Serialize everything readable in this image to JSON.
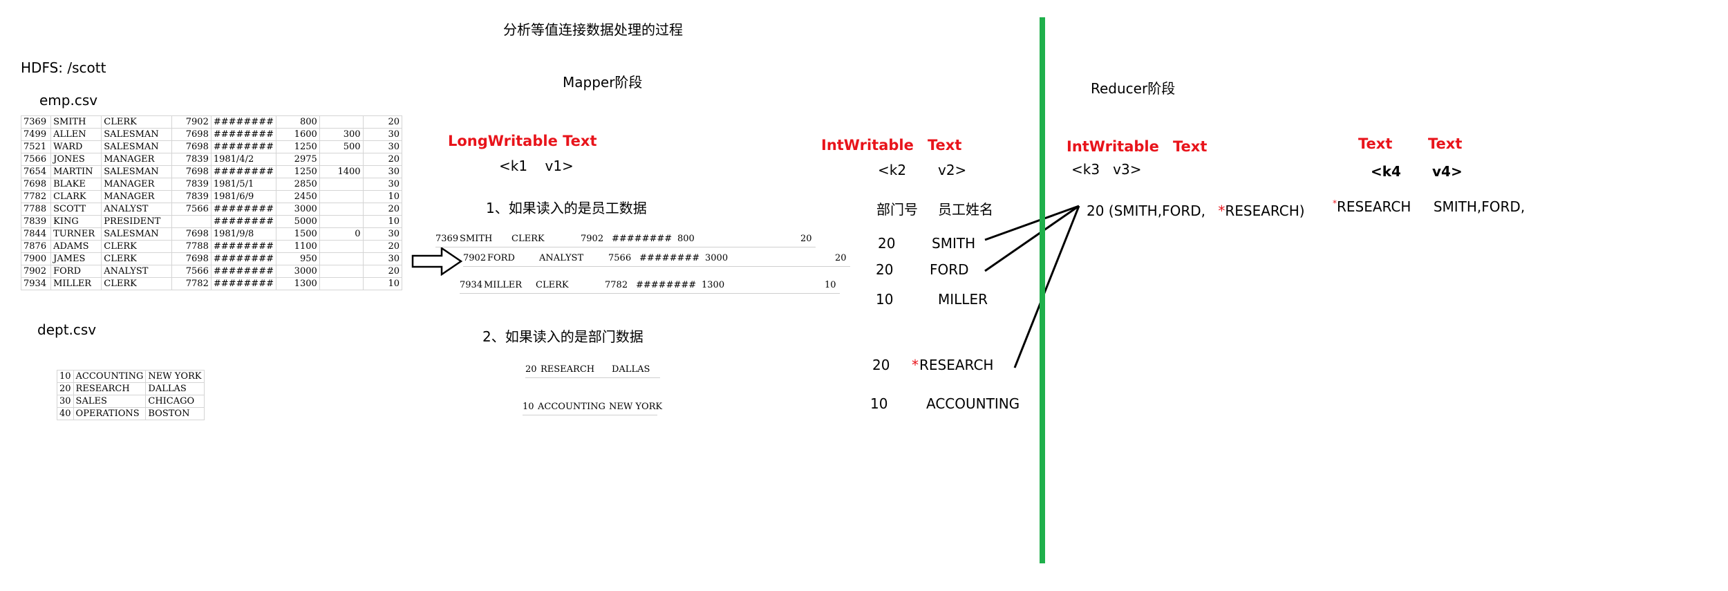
{
  "title": "分析等值连接数据处理的过程",
  "hdfs_label": "HDFS: /scott",
  "emp_label": "emp.csv",
  "dept_label": "dept.csv",
  "emp_rows": [
    [
      "7369",
      "SMITH",
      "CLERK",
      "7902",
      "########",
      "800",
      "",
      "20"
    ],
    [
      "7499",
      "ALLEN",
      "SALESMAN",
      "7698",
      "########",
      "1600",
      "300",
      "30"
    ],
    [
      "7521",
      "WARD",
      "SALESMAN",
      "7698",
      "########",
      "1250",
      "500",
      "30"
    ],
    [
      "7566",
      "JONES",
      "MANAGER",
      "7839",
      "1981/4/2",
      "2975",
      "",
      "20"
    ],
    [
      "7654",
      "MARTIN",
      "SALESMAN",
      "7698",
      "########",
      "1250",
      "1400",
      "30"
    ],
    [
      "7698",
      "BLAKE",
      "MANAGER",
      "7839",
      "1981/5/1",
      "2850",
      "",
      "30"
    ],
    [
      "7782",
      "CLARK",
      "MANAGER",
      "7839",
      "1981/6/9",
      "2450",
      "",
      "10"
    ],
    [
      "7788",
      "SCOTT",
      "ANALYST",
      "7566",
      "########",
      "3000",
      "",
      "20"
    ],
    [
      "7839",
      "KING",
      "PRESIDENT",
      "",
      "########",
      "5000",
      "",
      "10"
    ],
    [
      "7844",
      "TURNER",
      "SALESMAN",
      "7698",
      "1981/9/8",
      "1500",
      "0",
      "30"
    ],
    [
      "7876",
      "ADAMS",
      "CLERK",
      "7788",
      "########",
      "1100",
      "",
      "20"
    ],
    [
      "7900",
      "JAMES",
      "CLERK",
      "7698",
      "########",
      "950",
      "",
      "30"
    ],
    [
      "7902",
      "FORD",
      "ANALYST",
      "7566",
      "########",
      "3000",
      "",
      "20"
    ],
    [
      "7934",
      "MILLER",
      "CLERK",
      "7782",
      "########",
      "1300",
      "",
      "10"
    ]
  ],
  "dept_rows": [
    [
      "10",
      "ACCOUNTING",
      "NEW YORK"
    ],
    [
      "20",
      "RESEARCH",
      "DALLAS"
    ],
    [
      "30",
      "SALES",
      "CHICAGO"
    ],
    [
      "40",
      "OPERATIONS",
      "BOSTON"
    ]
  ],
  "mapper": {
    "stage_label": "Mapper阶段",
    "input_types": "LongWritable Text",
    "input_kv": "<k1    v1>",
    "case1": "1、如果读入的是员工数据",
    "case2": "2、如果读入的是部门数据",
    "emp_samples": [
      [
        "7369",
        "SMITH",
        "CLERK",
        "7902",
        "########",
        "800",
        "",
        "20"
      ],
      [
        "7902",
        "FORD",
        "ANALYST",
        "7566",
        "########",
        "3000",
        "",
        "20"
      ],
      [
        "7934",
        "MILLER",
        "CLERK",
        "7782",
        "########",
        "1300",
        "",
        "10"
      ]
    ],
    "dept_samples": [
      [
        "20",
        "RESEARCH",
        "DALLAS"
      ],
      [
        "10",
        "ACCOUNTING",
        "NEW YORK"
      ]
    ],
    "output_type_key": "IntWritable",
    "output_type_value": "Text",
    "output_kv_key": "<k2",
    "output_kv_value": "v2>",
    "col_dept": "部门号",
    "col_name": "员工姓名",
    "outputs": [
      {
        "k": "20",
        "v": "SMITH",
        "star": ""
      },
      {
        "k": "20",
        "v": "FORD",
        "star": ""
      },
      {
        "k": "10",
        "v": "MILLER",
        "star": ""
      },
      {
        "k": "20",
        "v": "RESEARCH",
        "star": "*"
      },
      {
        "k": "10",
        "v": "ACCOUNTING",
        "star": ""
      }
    ]
  },
  "reducer": {
    "stage_label": "Reducer阶段",
    "input_type_key": "IntWritable",
    "input_type_value": "Text",
    "input_kv": "<k3   v3>",
    "group_text": "20 (SMITH,FORD,",
    "group_star": "*",
    "group_dept": "RESEARCH)",
    "output_type_key": "Text",
    "output_type_value": "Text",
    "output_kv_key": "<k4",
    "output_kv_value": "v4>",
    "result_star": "*",
    "result_key": "RESEARCH",
    "result_value": "SMITH,FORD,"
  },
  "colors": {
    "divider": "#1fb04b",
    "accent": "#e8141b"
  }
}
